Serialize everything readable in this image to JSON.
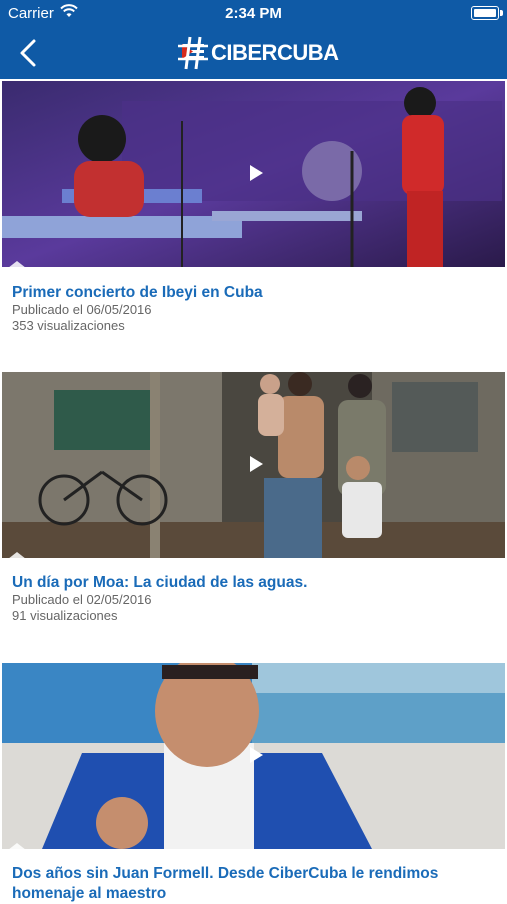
{
  "status_bar": {
    "carrier": "Carrier",
    "time": "2:34 PM"
  },
  "header": {
    "logo_text": "CIBERCUBA",
    "back_icon": "chevron-left-icon"
  },
  "colors": {
    "header_bg": "#0f5aa6",
    "title": "#1a6bb8",
    "meta": "#666666"
  },
  "videos": [
    {
      "title": "Primer concierto de Ibeyi en Cuba",
      "published": "Publicado el 06/05/2016",
      "views": "353 visualizaciones"
    },
    {
      "title": "Un día por Moa: La ciudad de las aguas.",
      "published": "Publicado el 02/05/2016",
      "views": "91 visualizaciones"
    },
    {
      "title": "Dos años sin Juan Formell. Desde CiberCuba le rendimos homenaje al maestro"
    }
  ]
}
